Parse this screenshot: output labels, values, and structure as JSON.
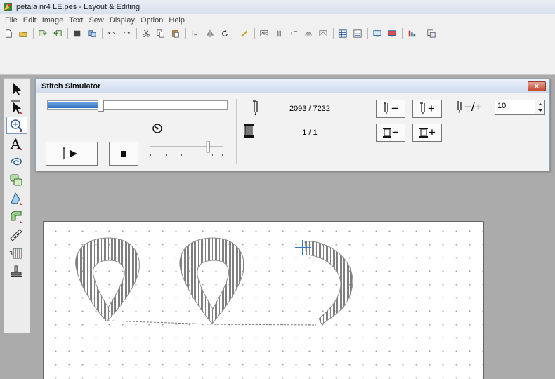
{
  "window": {
    "title": "petala nr4 LE.pes - Layout & Editing"
  },
  "menu": {
    "items": [
      "File",
      "Edit",
      "Image",
      "Text",
      "Sew",
      "Display",
      "Option",
      "Help"
    ]
  },
  "toolbar": {
    "icons": [
      "new-file-icon",
      "open-folder-icon",
      "import-icon",
      "export-icon",
      "fill-icon",
      "transfer-icon",
      "undo-icon",
      "redo-icon",
      "cut-icon",
      "copy-icon",
      "paste-icon",
      "align-icon",
      "flip-icon",
      "rotate-icon",
      "magic-wand-icon",
      "font-abc-icon",
      "vertical-text-icon",
      "text-effect-icon",
      "text-arc-icon",
      "text-path-icon",
      "grid-icon",
      "thread-table-icon",
      "monitor-icon",
      "monitor-color-icon",
      "sew-order-icon",
      "preview-icon"
    ],
    "separator_after": [
      1,
      3,
      5,
      7,
      10,
      13,
      14,
      19,
      21,
      23,
      24
    ]
  },
  "toolbox": {
    "icons": [
      "select-arrow-icon",
      "point-edit-icon",
      "zoom-icon",
      "text-tool-icon",
      "outline-tool-icon",
      "shape-tool-icon",
      "stitch-tool-icon",
      "pattern-tool-icon",
      "measure-icon",
      "stitch-edit-icon",
      "stamp-icon"
    ],
    "active_index": 2
  },
  "simulator": {
    "title": "Stitch Simulator",
    "close_label": "×",
    "progress": 0.29,
    "stitch_current": 2093,
    "stitch_total": 7232,
    "stitch_text": "2093 / 7232",
    "color_text": "1 / 1",
    "buttons": {
      "stitch_minus": "−",
      "stitch_plus": "+",
      "color_minus": "−",
      "color_plus": "+",
      "step_label": "−/+"
    },
    "step_value": "10",
    "speed_level": 0.8
  },
  "colors": {
    "accent": "#3a78c8",
    "stitch": "#8c8c8c"
  }
}
